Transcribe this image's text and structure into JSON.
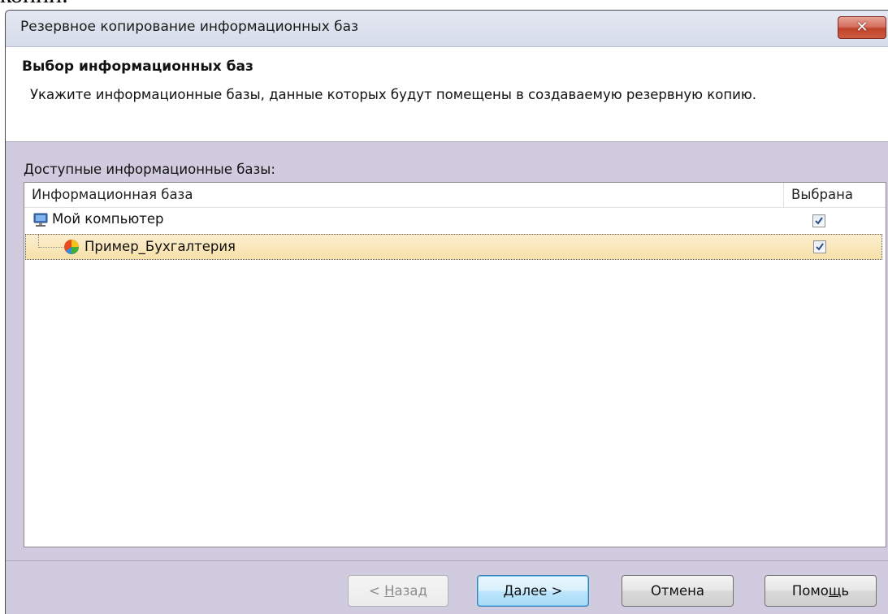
{
  "top_cut_text": "копии.",
  "window": {
    "title": "Резервное копирование информационных баз",
    "close_label": "✕"
  },
  "header": {
    "title": "Выбор информационных баз",
    "description": "Укажите информационные базы, данные которых будут помещены в создаваемую резервную копию."
  },
  "list": {
    "label": "Доступные информационные базы:",
    "columns": [
      "Информационная база",
      "Выбрана"
    ],
    "rows": [
      {
        "label": "Мой компьютер",
        "checked": true,
        "icon": "computer-icon"
      },
      {
        "label": "Пример_Бухгалтерия",
        "checked": true,
        "icon": "infobase-icon",
        "highlighted": true
      }
    ]
  },
  "buttons": {
    "back_prefix": "< ",
    "back_access": "Н",
    "back_rest": "азад",
    "next_access": "Д",
    "next_rest": "алее >",
    "cancel": "Отмена",
    "help_prefix": "Помо",
    "help_access": "щ",
    "help_rest": "ь"
  },
  "colors": {
    "window_bg": "#d1cbdf",
    "selection": "#f7e0a8",
    "close_button": "#c0432c"
  }
}
